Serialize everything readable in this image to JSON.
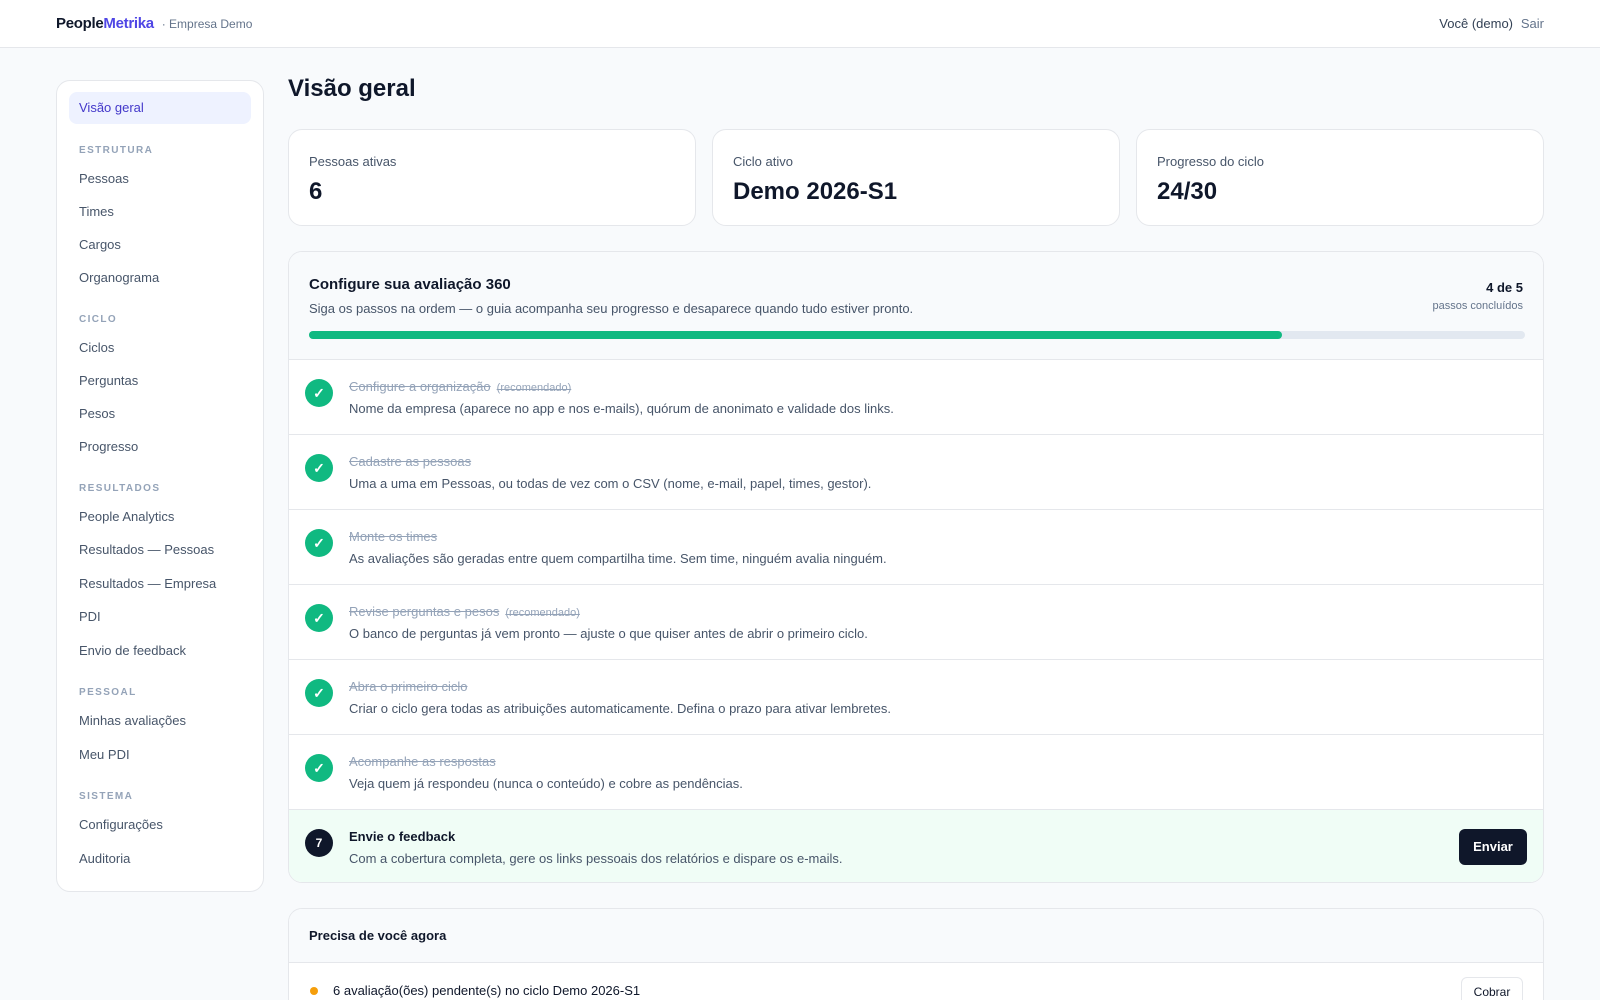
{
  "header": {
    "brand_part1": "People",
    "brand_part2": "Metrika",
    "org": "· Empresa Demo",
    "user": "Você (demo)",
    "logout": "Sair"
  },
  "sidebar": {
    "overview": "Visão geral",
    "sections": [
      {
        "title": "ESTRUTURA",
        "items": [
          "Pessoas",
          "Times",
          "Cargos",
          "Organograma"
        ]
      },
      {
        "title": "CICLO",
        "items": [
          "Ciclos",
          "Perguntas",
          "Pesos",
          "Progresso"
        ]
      },
      {
        "title": "RESULTADOS",
        "items": [
          "People Analytics",
          "Resultados — Pessoas",
          "Resultados — Empresa",
          "PDI",
          "Envio de feedback"
        ]
      },
      {
        "title": "PESSOAL",
        "items": [
          "Minhas avaliações",
          "Meu PDI"
        ]
      },
      {
        "title": "SISTEMA",
        "items": [
          "Configurações",
          "Auditoria"
        ]
      }
    ]
  },
  "page": {
    "title": "Visão geral"
  },
  "stats": [
    {
      "label": "Pessoas ativas",
      "value": "6"
    },
    {
      "label": "Ciclo ativo",
      "value": "Demo 2026-S1"
    },
    {
      "label": "Progresso do ciclo",
      "value": "24/30"
    }
  ],
  "setup": {
    "title": "Configure sua avaliação 360",
    "subtitle": "Siga os passos na ordem — o guia acompanha seu progresso e desaparece quando tudo estiver pronto.",
    "count": "4 de 5",
    "count_label": "passos concluídos",
    "progress": 0.8,
    "check_glyph": "✓",
    "steps": [
      {
        "title": "Configure a organização",
        "tag": "(recomendado)",
        "desc": "Nome da empresa (aparece no app e nos e-mails), quórum de anonimato e validade dos links."
      },
      {
        "title": "Cadastre as pessoas",
        "tag": "",
        "desc": "Uma a uma em Pessoas, ou todas de vez com o CSV (nome, e-mail, papel, times, gestor)."
      },
      {
        "title": "Monte os times",
        "tag": "",
        "desc": "As avaliações são geradas entre quem compartilha time. Sem time, ninguém avalia ninguém."
      },
      {
        "title": "Revise perguntas e pesos",
        "tag": "(recomendado)",
        "desc": "O banco de perguntas já vem pronto — ajuste o que quiser antes de abrir o primeiro ciclo."
      },
      {
        "title": "Abra o primeiro ciclo",
        "tag": "",
        "desc": "Criar o ciclo gera todas as atribuições automaticamente. Defina o prazo para ativar lembretes."
      },
      {
        "title": "Acompanhe as respostas",
        "tag": "",
        "desc": "Veja quem já respondeu (nunca o conteúdo) e cobre as pendências."
      }
    ],
    "current_step": {
      "number": "7",
      "title": "Envie o feedback",
      "desc": "Com a cobertura completa, gere os links pessoais dos relatórios e dispare os e-mails.",
      "button": "Enviar"
    }
  },
  "needs": {
    "title": "Precisa de você agora",
    "item_text": "6 avaliação(ões) pendente(s) no ciclo Demo 2026-S1",
    "item_button": "Cobrar",
    "dot_color": "#f59e0b"
  }
}
